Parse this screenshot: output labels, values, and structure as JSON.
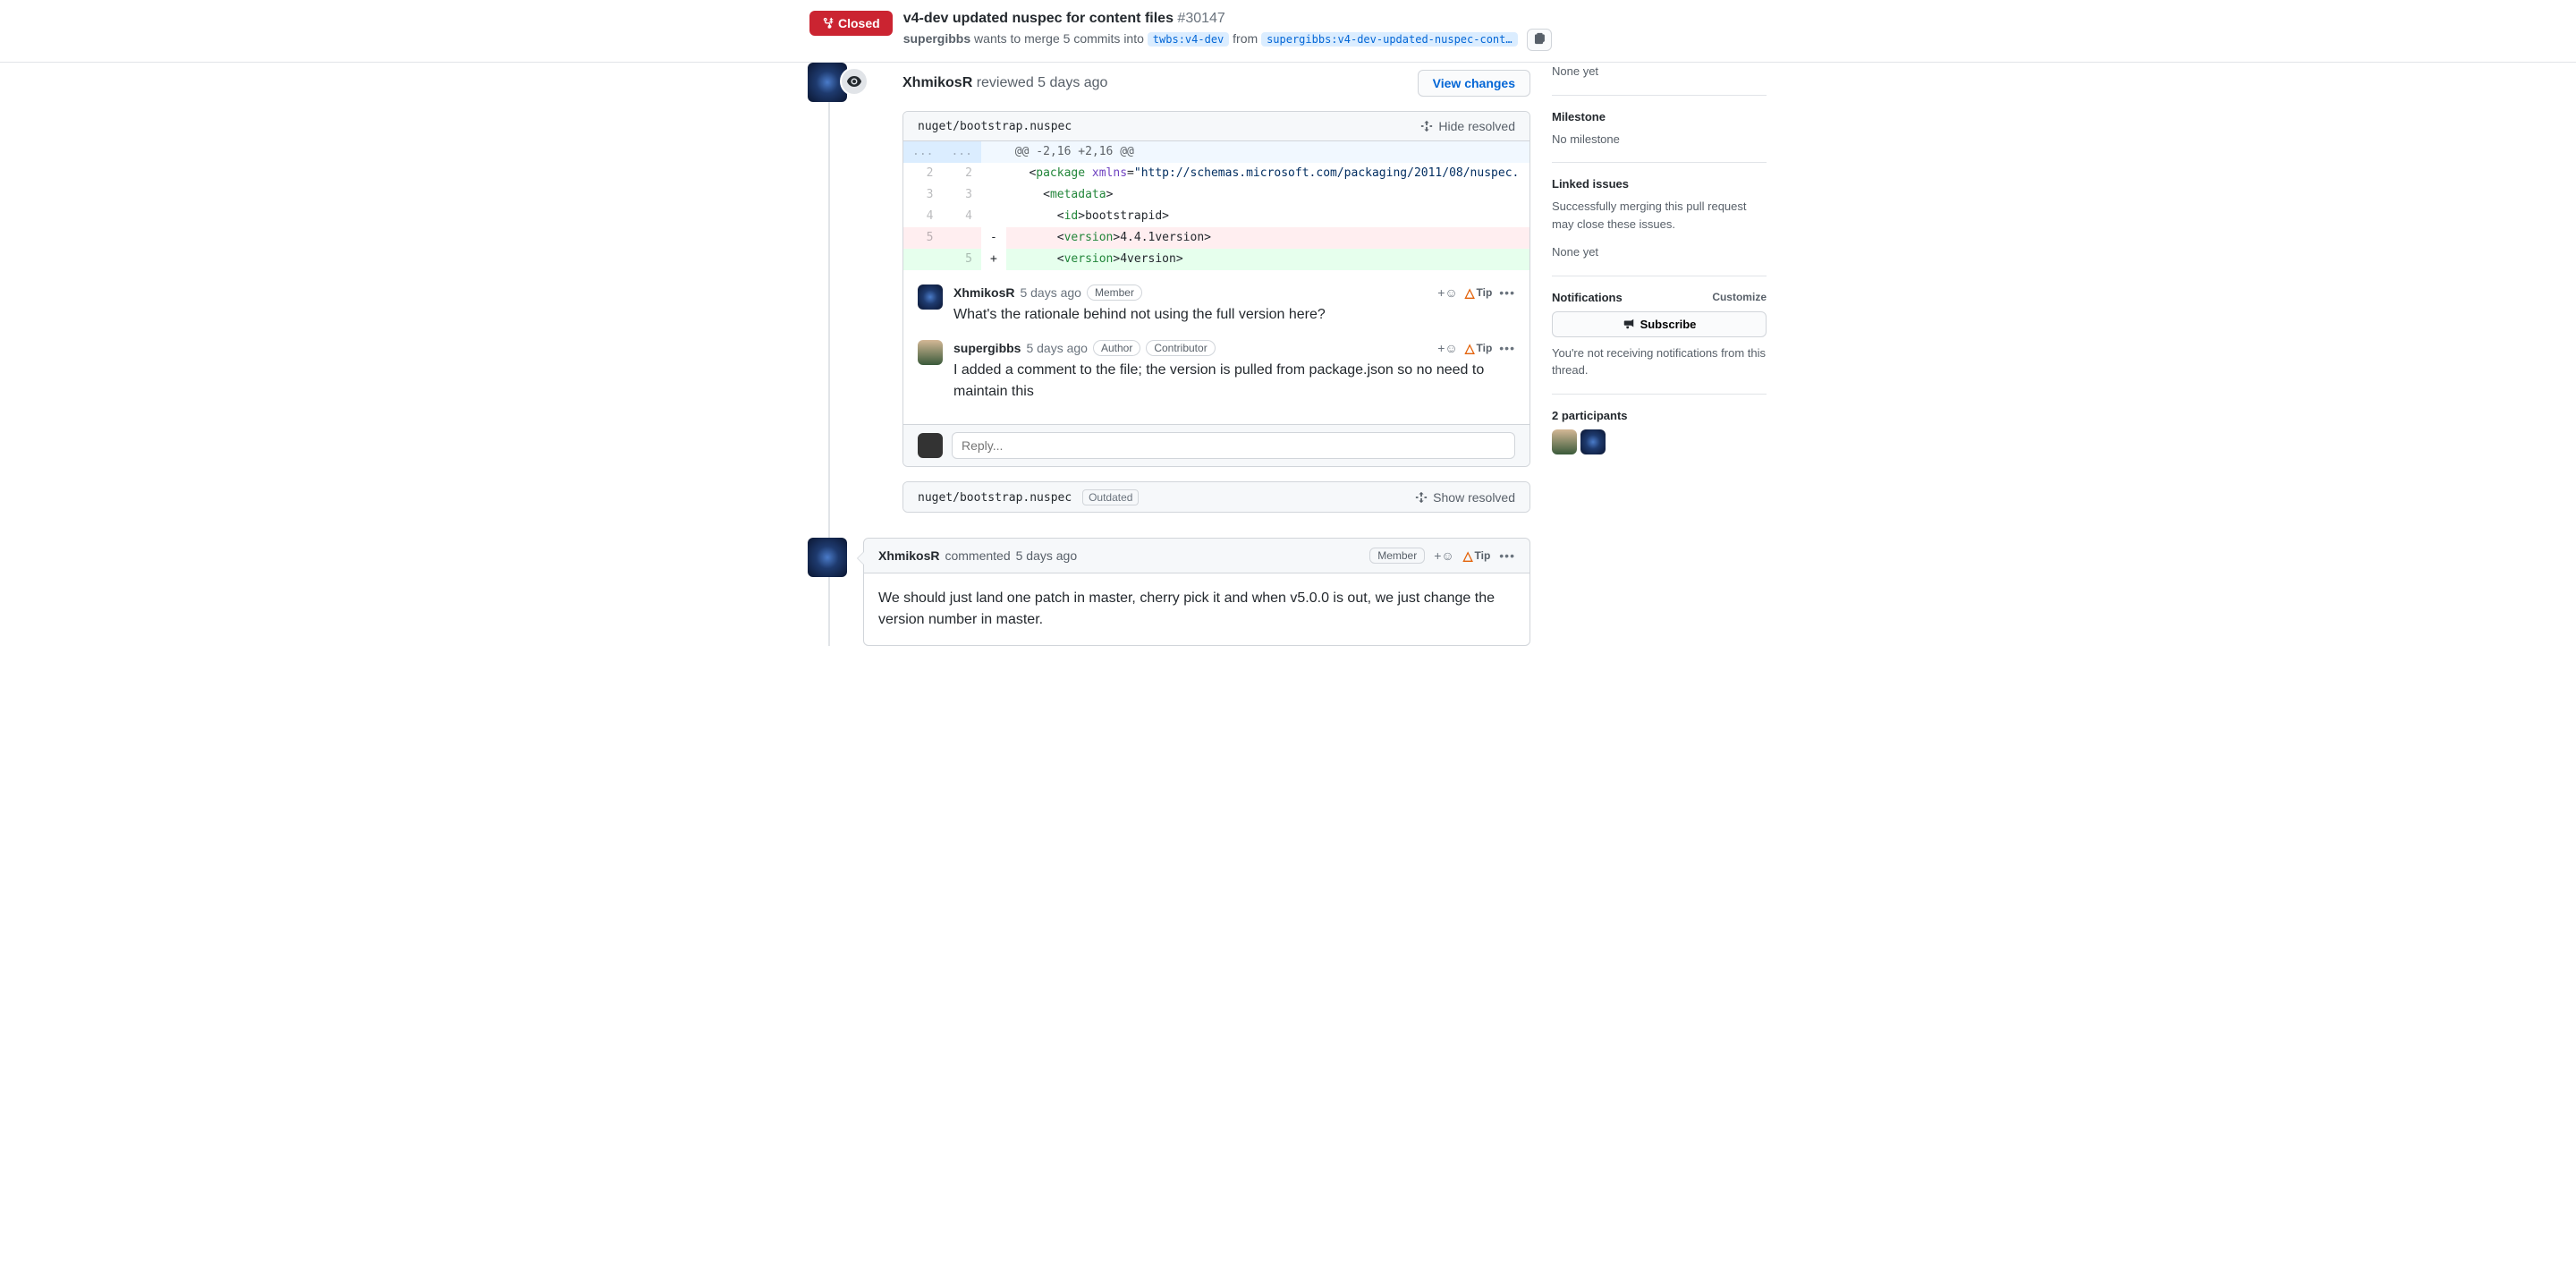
{
  "header": {
    "status": "Closed",
    "title": "v4-dev updated nuspec for content files",
    "issue_number": "#30147",
    "meta_author": "supergibbs",
    "meta_text": " wants to merge 5 commits into ",
    "base_branch": "twbs:v4-dev",
    "from_text": " from ",
    "head_branch": "supergibbs:v4-dev-updated-nuspec-cont…"
  },
  "review": {
    "author": "XhmikosR",
    "action": " reviewed ",
    "time": "5 days ago",
    "view_changes": "View changes",
    "file_path": "nuget/bootstrap.nuspec",
    "hide_resolved": "Hide resolved",
    "hunk_header": "@@ -2,16 +2,16 @@",
    "diff": {
      "line2": {
        "left": "2",
        "right": "2",
        "sign": "",
        "html": "  <<span class='tag-open'>package</span> <span class='tag-attr'>xmlns</span>=<span class='tag-str'>\"http://schemas.microsoft.com/packaging/2011/08/nuspec.</span>"
      },
      "line3": {
        "left": "3",
        "right": "3",
        "sign": "",
        "html": "    <<span class='tag-open'>metadata</span>>"
      },
      "line4": {
        "left": "4",
        "right": "4",
        "sign": "",
        "html": "      <<span class='tag-open'>id</span>>bootstrap</<span class='tag-open'>id</span>>"
      },
      "line5del": {
        "left": "5",
        "right": "",
        "sign": "-",
        "html": "      <<span class='tag-open'>version</span>>4<span class='tag-txt'>.</span>4<span class='tag-txt'>.</span>1</<span class='tag-open'>version</span>>"
      },
      "line5add": {
        "left": "",
        "right": "5",
        "sign": "+",
        "html": "      <<span class='tag-open'>version</span>>4</<span class='tag-open'>version</span>>"
      }
    },
    "comments": [
      {
        "author": "XhmikosR",
        "time": "5 days ago",
        "badges": [
          "Member"
        ],
        "text": "What's the rationale behind not using the full version here?",
        "avatar_class": ""
      },
      {
        "author": "supergibbs",
        "time": "5 days ago",
        "badges": [
          "Author",
          "Contributor"
        ],
        "text": "I added a comment to the file; the version is pulled from package.json so no need to maintain this",
        "avatar_class": "human"
      }
    ],
    "tip_label": "Tip",
    "reply_placeholder": "Reply...",
    "outdated_file_path": "nuget/bootstrap.nuspec",
    "outdated_label": "Outdated",
    "show_resolved": "Show resolved"
  },
  "comment": {
    "author": "XhmikosR",
    "action": " commented ",
    "time": "5 days ago",
    "badge": "Member",
    "tip_label": "Tip",
    "body": "We should just land one patch in master, cherry pick it and when v5.0.0 is out, we just change the version number in master."
  },
  "sidebar": {
    "none_yet": "None yet",
    "milestone_title": "Milestone",
    "milestone_text": "No milestone",
    "linked_title": "Linked issues",
    "linked_text": "Successfully merging this pull request may close these issues.",
    "linked_none": "None yet",
    "notifications_title": "Notifications",
    "customize": "Customize",
    "subscribe": "Subscribe",
    "notifications_text": "You're not receiving notifications from this thread.",
    "participants_title": "2 participants"
  }
}
